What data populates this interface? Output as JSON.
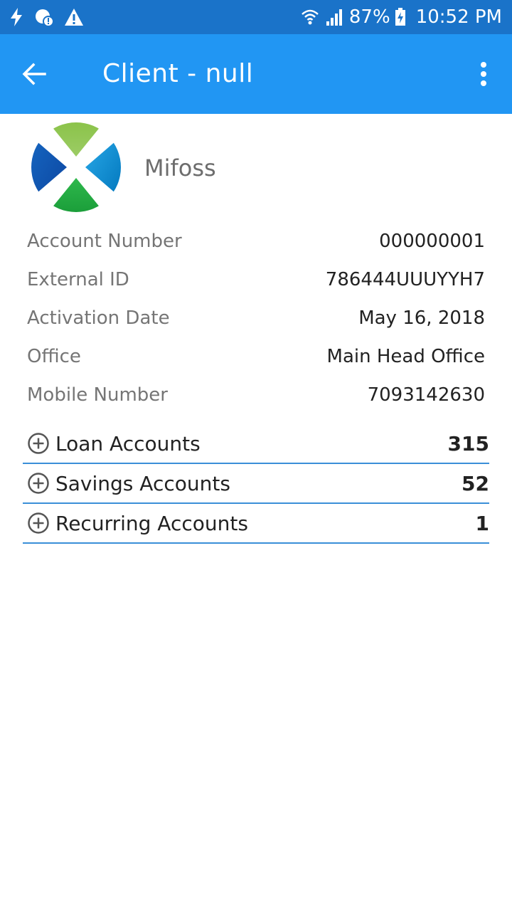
{
  "status_bar": {
    "icons_left": [
      "flash-icon",
      "data-saver-icon",
      "warning-icon"
    ],
    "icons_right": [
      "wifi-icon",
      "signal-icon",
      "battery-charging-icon"
    ],
    "battery_level": "87%",
    "time": "10:52 PM",
    "color": "#1a73c9"
  },
  "app_bar": {
    "title": "Client - null",
    "color": "#2196f3"
  },
  "client": {
    "name": "Mifoss"
  },
  "details": [
    {
      "label": "Account Number",
      "value": "000000001"
    },
    {
      "label": "External ID",
      "value": "786444UUUYYH7"
    },
    {
      "label": "Activation Date",
      "value": "May 16, 2018"
    },
    {
      "label": "Office",
      "value": "Main Head Office"
    },
    {
      "label": "Mobile Number",
      "value": "7093142630"
    }
  ],
  "accounts": [
    {
      "label": "Loan Accounts",
      "count": "315"
    },
    {
      "label": "Savings Accounts",
      "count": "52"
    },
    {
      "label": "Recurring Accounts",
      "count": "1"
    }
  ],
  "colors": {
    "divider": "#3a8fd8"
  }
}
